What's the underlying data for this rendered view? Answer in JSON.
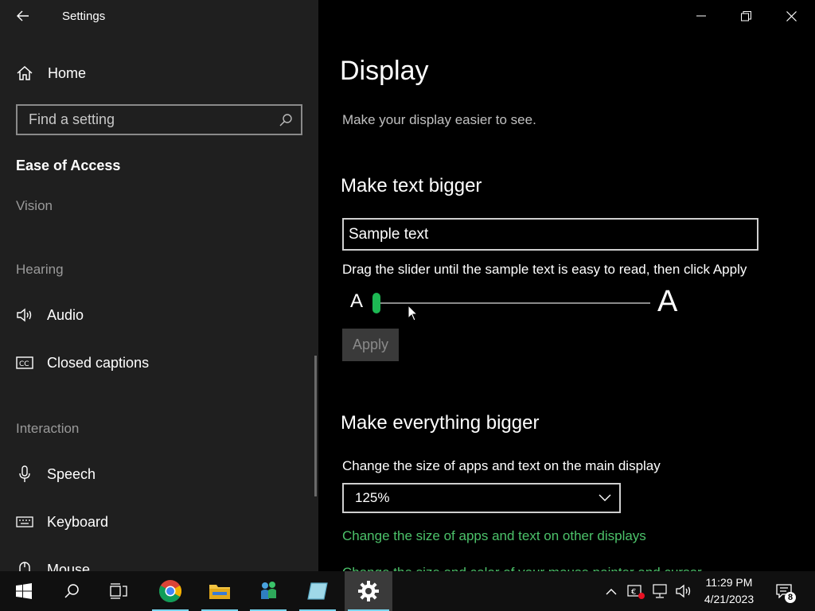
{
  "window": {
    "title": "Settings"
  },
  "sidebar": {
    "home_label": "Home",
    "search_placeholder": "Find a setting",
    "section_title": "Ease of Access",
    "groups": {
      "vision": "Vision",
      "hearing": "Hearing",
      "interaction": "Interaction"
    },
    "items": {
      "audio": "Audio",
      "closed_captions": "Closed captions",
      "speech": "Speech",
      "keyboard": "Keyboard",
      "mouse": "Mouse"
    }
  },
  "main": {
    "page_title": "Display",
    "subtitle": "Make your display easier to see.",
    "text_section": {
      "heading": "Make text bigger",
      "sample_text": "Sample text",
      "instructions": "Drag the slider until the sample text is easy to read, then click Apply",
      "small_a": "A",
      "large_a": "A",
      "slider_value_fraction": 0.0,
      "apply_label": "Apply"
    },
    "everything_section": {
      "heading": "Make everything bigger",
      "description": "Change the size of apps and text on the main display",
      "scale_value": "125%",
      "other_displays_link": "Change the size of apps and text on other displays",
      "partial_link": "Change the size and color of your mouse pointer and cursor"
    }
  },
  "taskbar": {
    "time": "11:29 PM",
    "date": "4/21/2023",
    "notification_count": "8"
  },
  "colors": {
    "accent": "#1db954",
    "link": "#4cc26a",
    "sidebar_bg": "#1f1f1f",
    "main_bg": "#000000"
  }
}
